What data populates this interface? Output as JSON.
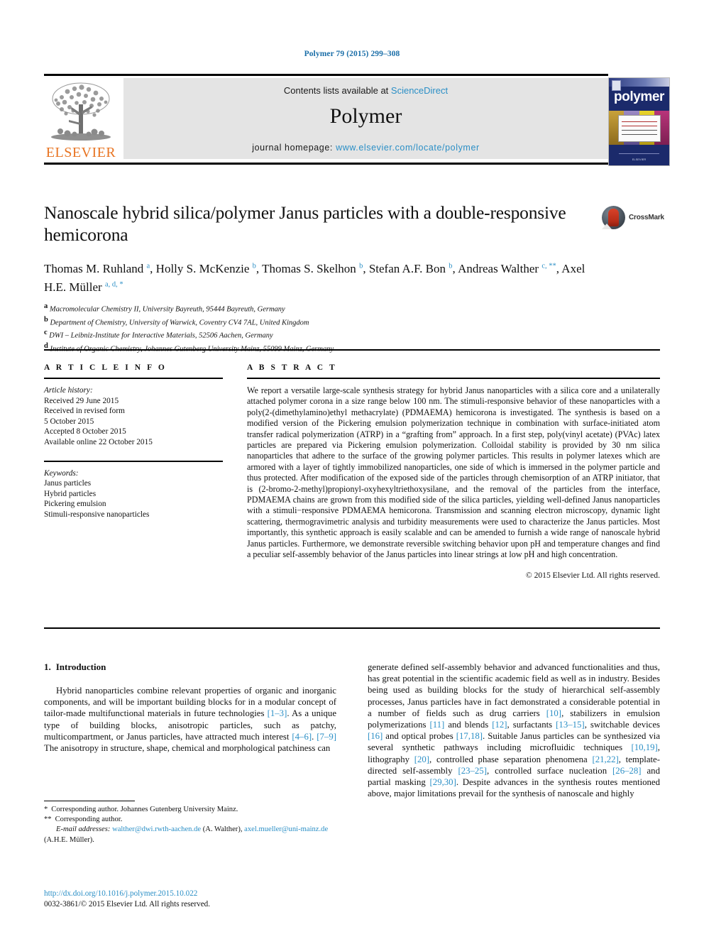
{
  "running_head": "Polymer 79 (2015) 299–308",
  "masthead": {
    "contents_prefix": "Contents lists available at ",
    "contents_link": "ScienceDirect",
    "journal_name": "Polymer",
    "homepage_prefix": "journal homepage: ",
    "homepage_url": "www.elsevier.com/locate/polymer",
    "publisher_logo_text": "ELSEVIER",
    "cover_title": "polymer"
  },
  "article": {
    "title": "Nanoscale hybrid silica/polymer Janus particles with a double-responsive hemicorona",
    "crossmark_label": "CrossMark",
    "authors": [
      {
        "name": "Thomas M. Ruhland",
        "marks": "a",
        "sep": ", "
      },
      {
        "name": "Holly S. McKenzie",
        "marks": "b",
        "sep": ", "
      },
      {
        "name": "Thomas S. Skelhon",
        "marks": "b",
        "sep": ", "
      },
      {
        "name": "Stefan A.F. Bon",
        "marks": "b",
        "sep": ", "
      },
      {
        "name": "Andreas Walther",
        "marks": "c, **",
        "sep": ", "
      },
      {
        "name": "Axel H.E. Müller",
        "marks": "a, d, *",
        "sep": ""
      }
    ],
    "affiliations": [
      {
        "mark": "a",
        "text": "Macromolecular Chemistry II, University Bayreuth, 95444 Bayreuth, Germany"
      },
      {
        "mark": "b",
        "text": "Department of Chemistry, University of Warwick, Coventry CV4 7AL, United Kingdom"
      },
      {
        "mark": "c",
        "text": "DWI – Leibniz-Institute for Interactive Materials, 52506 Aachen, Germany"
      },
      {
        "mark": "d",
        "text": "Institute of Organic Chemistry, Johannes Gutenberg University Mainz, 55099 Mainz, Germany"
      }
    ]
  },
  "article_info": {
    "heading": "A R T I C L E  I N F O",
    "history_label": "Article history:",
    "history": [
      "Received 29 June 2015",
      "Received in revised form",
      "5 October 2015",
      "Accepted 8 October 2015",
      "Available online 22 October 2015"
    ],
    "keywords_label": "Keywords:",
    "keywords": [
      "Janus particles",
      "Hybrid particles",
      "Pickering emulsion",
      "Stimuli-responsive nanoparticles"
    ]
  },
  "abstract": {
    "heading": "A B S T R A C T",
    "text": "We report a versatile large-scale synthesis strategy for hybrid Janus nanoparticles with a silica core and a unilaterally attached polymer corona in a size range below 100 nm. The stimuli-responsive behavior of these nanoparticles with a poly(2-(dimethylamino)ethyl methacrylate) (PDMAEMA) hemicorona is investigated. The synthesis is based on a modified version of the Pickering emulsion polymerization technique in combination with surface-initiated atom transfer radical polymerization (ATRP) in a “grafting from” approach. In a first step, poly(vinyl acetate) (PVAc) latex particles are prepared via Pickering emulsion polymerization. Colloidal stability is provided by 30 nm silica nanoparticles that adhere to the surface of the growing polymer particles. This results in polymer latexes which are armored with a layer of tightly immobilized nanoparticles, one side of which is immersed in the polymer particle and thus protected. After modification of the exposed side of the particles through chemisorption of an ATRP initiator, that is (2-bromo-2-methyl)propionyl-oxyhexyltriethoxysilane, and the removal of the particles from the interface, PDMAEMA chains are grown from this modified side of the silica particles, yielding well-defined Janus nanoparticles with a stimuli−responsive PDMAEMA hemicorona. Transmission and scanning electron microscopy, dynamic light scattering, thermogravimetric analysis and turbidity measurements were used to characterize the Janus particles. Most importantly, this synthetic approach is easily scalable and can be amended to furnish a wide range of nanoscale hybrid Janus particles. Furthermore, we demonstrate reversible switching behavior upon pH and temperature changes and find a peculiar self-assembly behavior of the Janus particles into linear strings at low pH and high concentration.",
    "copyright": "© 2015 Elsevier Ltd. All rights reserved."
  },
  "introduction": {
    "number": "1.",
    "heading": "Introduction",
    "left_paragraph_parts": [
      {
        "t": "Hybrid nanoparticles combine relevant properties of organic and inorganic components, and will be important building blocks for in a modular concept of tailor-made multifunctional materials in future technologies ",
        "link": false
      },
      {
        "t": "[1–3]",
        "link": true
      },
      {
        "t": ". As a unique type of building blocks, anisotropic particles, such as patchy, multicompartment, or Janus particles, have attracted much interest ",
        "link": false
      },
      {
        "t": "[4–6]",
        "link": true
      },
      {
        "t": ". ",
        "link": false
      },
      {
        "t": "[7–9]",
        "link": true
      },
      {
        "t": " The anisotropy in structure, shape, chemical and morphological patchiness can",
        "link": false
      }
    ],
    "right_paragraph_parts": [
      {
        "t": "generate defined self-assembly behavior and advanced functionalities and thus, has great potential in the scientific academic field as well as in industry. Besides being used as building blocks for the study of hierarchical self-assembly processes, Janus particles have in fact demonstrated a considerable potential in a number of fields such as drug carriers ",
        "link": false
      },
      {
        "t": "[10]",
        "link": true
      },
      {
        "t": ", stabilizers in emulsion polymerizations ",
        "link": false
      },
      {
        "t": "[11]",
        "link": true
      },
      {
        "t": " and blends ",
        "link": false
      },
      {
        "t": "[12]",
        "link": true
      },
      {
        "t": ", surfactants ",
        "link": false
      },
      {
        "t": "[13–15]",
        "link": true
      },
      {
        "t": ", switchable devices ",
        "link": false
      },
      {
        "t": "[16]",
        "link": true
      },
      {
        "t": " and optical probes ",
        "link": false
      },
      {
        "t": "[17,18]",
        "link": true
      },
      {
        "t": ". Suitable Janus particles can be synthesized via several synthetic pathways including microfluidic techniques ",
        "link": false
      },
      {
        "t": "[10,19]",
        "link": true
      },
      {
        "t": ", lithography ",
        "link": false
      },
      {
        "t": "[20]",
        "link": true
      },
      {
        "t": ", controlled phase separation phenomena ",
        "link": false
      },
      {
        "t": "[21,22]",
        "link": true
      },
      {
        "t": ", template-directed self-assembly ",
        "link": false
      },
      {
        "t": "[23–25]",
        "link": true
      },
      {
        "t": ", controlled surface nucleation ",
        "link": false
      },
      {
        "t": "[26–28]",
        "link": true
      },
      {
        "t": " and partial masking ",
        "link": false
      },
      {
        "t": "[29,30]",
        "link": true
      },
      {
        "t": ". Despite advances in the synthesis routes mentioned above, major limitations prevail for the synthesis of nanoscale and highly",
        "link": false
      }
    ]
  },
  "footnotes": {
    "corresponding_1_mark": "*",
    "corresponding_1": "Corresponding author. Johannes Gutenberg University Mainz.",
    "corresponding_2_mark": "**",
    "corresponding_2": "Corresponding author.",
    "email_label": "E-mail addresses:",
    "email_1": "walther@dwi.rwth-aachen.de",
    "email_1_name": " (A. Walther), ",
    "email_2": "axel.mueller@uni-mainz.de",
    "email_2_name": " (A.H.E. Müller).",
    "doi": "http://dx.doi.org/10.1016/j.polymer.2015.10.022",
    "issn": "0032-3861/© 2015 Elsevier Ltd. All rights reserved."
  },
  "colors": {
    "link": "#2b8fc6",
    "elsevier_orange": "#e87422",
    "band_gray": "#e4e4e4",
    "cover_blue": "#1b2a6b"
  }
}
